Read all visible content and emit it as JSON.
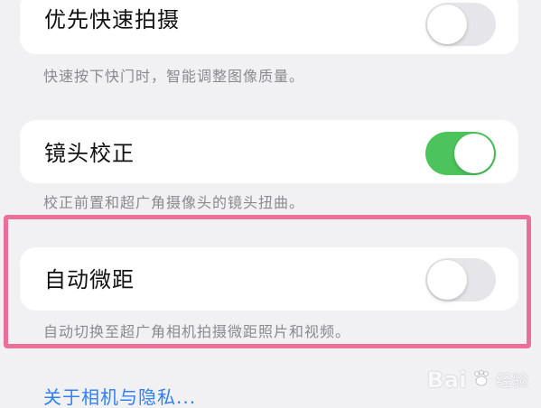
{
  "settings": {
    "rows": [
      {
        "label": "优先快速拍摄",
        "description": "快速按下快门时，智能调整图像质量。",
        "enabled": false
      },
      {
        "label": "镜头校正",
        "description": "校正前置和超广角摄像头的镜头扭曲。",
        "enabled": true
      },
      {
        "label": "自动微距",
        "description": "自动切换至超广角相机拍摄微距照片和视频。",
        "enabled": false
      }
    ],
    "privacy_link": "关于相机与隐私..."
  },
  "watermark": {
    "brand": "Bai",
    "brand_suffix": "经验"
  },
  "colors": {
    "toggle_on": "#4cc45b",
    "toggle_off": "#e6e6ea",
    "highlight": "#ec6f99",
    "link": "#2f7ff5"
  }
}
